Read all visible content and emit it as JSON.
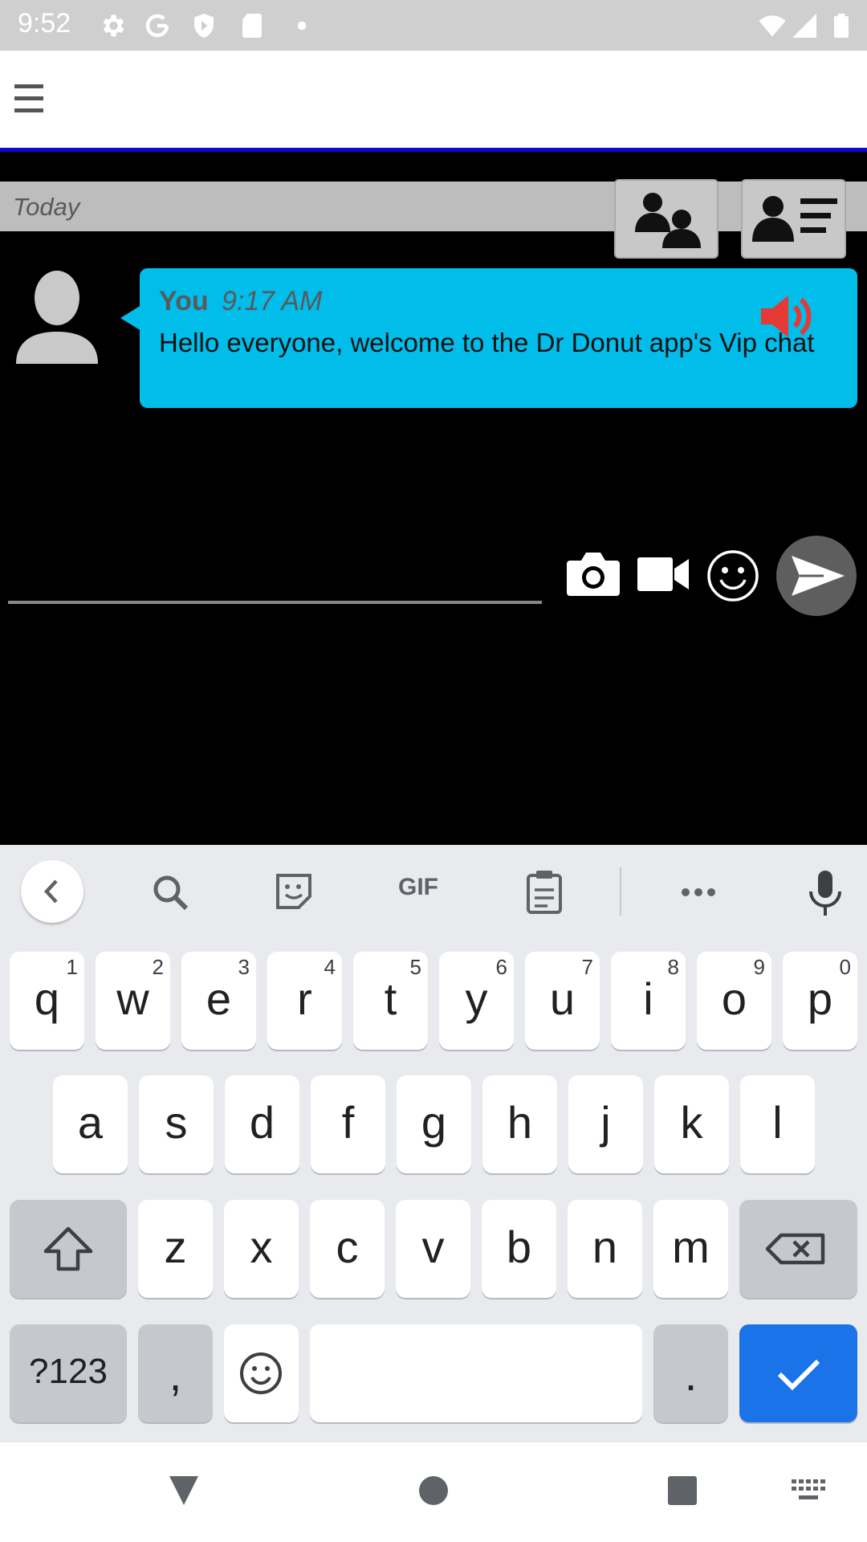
{
  "status_bar": {
    "time": "9:52",
    "icons": [
      "settings-icon",
      "google-icon",
      "shield-icon",
      "sd-card-icon",
      "dot-icon",
      "wifi-icon",
      "signal-icon",
      "battery-icon"
    ]
  },
  "app_bar": {
    "menu_icon": "hamburger-menu-icon"
  },
  "chat": {
    "date_label": "Today",
    "header_buttons": [
      "group-chat-icon",
      "user-list-icon"
    ],
    "messages": [
      {
        "sender": "You",
        "time": "9:17 AM",
        "text": "Hello everyone, welcome to the Dr Donut app's Vip chat",
        "icons": [
          "avatar-icon",
          "speaker-icon"
        ]
      }
    ]
  },
  "composer": {
    "input_value": "",
    "icons": [
      "camera-icon",
      "video-camera-icon",
      "emoji-icon",
      "send-icon"
    ]
  },
  "keyboard": {
    "toolbar": {
      "gif_label": "GIF",
      "icons": [
        "back-chevron-icon",
        "search-icon",
        "sticker-icon",
        "clipboard-icon",
        "more-icon",
        "microphone-icon"
      ]
    },
    "row1": [
      {
        "ch": "q",
        "hint": "1"
      },
      {
        "ch": "w",
        "hint": "2"
      },
      {
        "ch": "e",
        "hint": "3"
      },
      {
        "ch": "r",
        "hint": "4"
      },
      {
        "ch": "t",
        "hint": "5"
      },
      {
        "ch": "y",
        "hint": "6"
      },
      {
        "ch": "u",
        "hint": "7"
      },
      {
        "ch": "i",
        "hint": "8"
      },
      {
        "ch": "o",
        "hint": "9"
      },
      {
        "ch": "p",
        "hint": "0"
      }
    ],
    "row2": [
      "a",
      "s",
      "d",
      "f",
      "g",
      "h",
      "j",
      "k",
      "l"
    ],
    "row3": [
      "z",
      "x",
      "c",
      "v",
      "b",
      "n",
      "m"
    ],
    "symbols_label": "?123",
    "comma_label": ",",
    "period_label": ".",
    "icons": [
      "shift-icon",
      "backspace-icon",
      "emoji-key-icon",
      "check-icon"
    ]
  },
  "nav_bar": {
    "icons": [
      "back-triangle-icon",
      "home-circle-icon",
      "recents-square-icon",
      "keyboard-switch-icon"
    ]
  },
  "colors": {
    "bubble": "#00bdea",
    "appbar_border": "#0a0ad0",
    "speaker": "#e53935",
    "enter_key": "#1a73e8"
  }
}
